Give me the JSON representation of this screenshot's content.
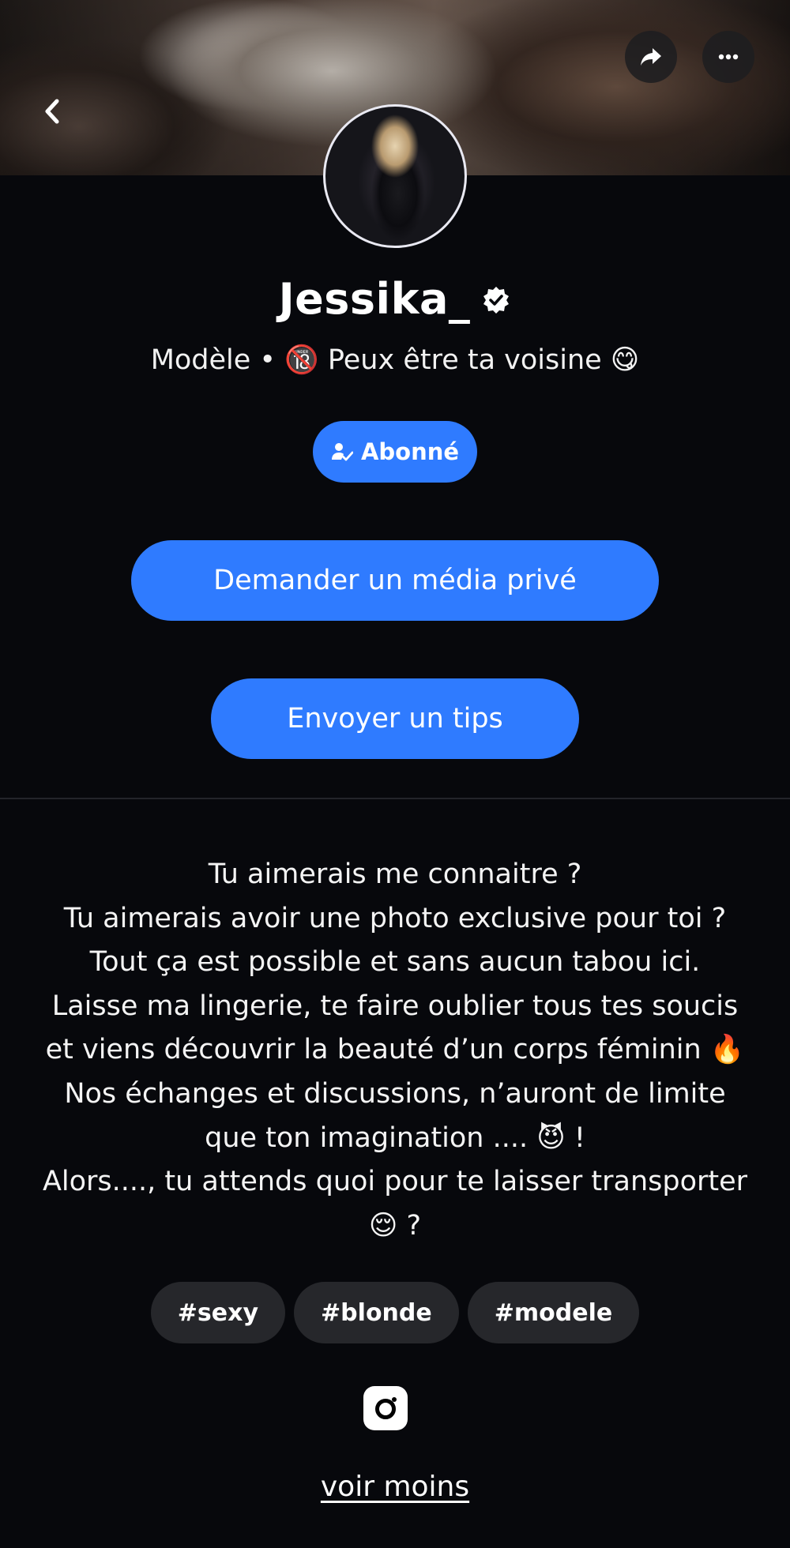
{
  "profile": {
    "name": "Jessika_",
    "bio_line": "Modèle • 🔞 Peux être ta voisine 😋"
  },
  "header": {
    "back_icon": "chevron-left-icon",
    "share_icon": "share-arrow-icon",
    "more_icon": "ellipsis-icon"
  },
  "actions": {
    "subscribed_label": "Abonné",
    "request_media_label": "Demander un média privé",
    "send_tip_label": "Envoyer un tips"
  },
  "description": {
    "lines": [
      "Tu aimerais me connaitre ?",
      "Tu aimerais avoir une photo exclusive pour toi ?",
      "Tout ça est possible et sans aucun tabou ici.",
      "Laisse ma lingerie, te faire oublier tous tes soucis",
      "et viens découvrir la beauté d’un corps féminin 🔥",
      "Nos échanges et discussions, n’auront de limite",
      "que ton imagination .... 😈 !",
      "Alors...., tu attends quoi pour te laisser transporter",
      "😌 ?"
    ]
  },
  "tags": [
    "#sexy",
    "#blonde",
    "#modele"
  ],
  "socials": {
    "instagram_icon": "instagram-icon"
  },
  "toggle_label": "voir moins",
  "colors": {
    "accent": "#2f7bff",
    "background": "#07080c",
    "chip": "#26272b"
  }
}
